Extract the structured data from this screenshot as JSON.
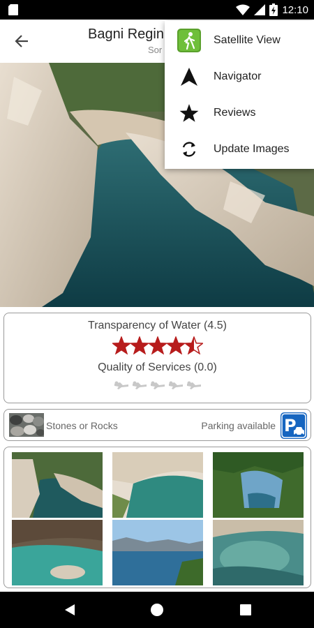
{
  "status_bar": {
    "time": "12:10"
  },
  "app_bar": {
    "title": "Bagni Regin",
    "subtitle": "Sor"
  },
  "menu": {
    "items": [
      {
        "label": "Satellite View",
        "icon": "hiker-icon"
      },
      {
        "label": "Navigator",
        "icon": "navigation-arrow-icon"
      },
      {
        "label": "Reviews",
        "icon": "star-icon"
      },
      {
        "label": "Update Images",
        "icon": "refresh-icon"
      }
    ]
  },
  "ratings": {
    "water": {
      "label": "Transparency of Water (4.5)",
      "value": 4.5,
      "max": 5,
      "color": "#b71c1c"
    },
    "services": {
      "label": "Quality of Services (0.0)",
      "value": 0.0,
      "max": 5,
      "color": "#c8c8c8"
    }
  },
  "info": {
    "beach_type": "Stones or Rocks",
    "parking": "Parking available",
    "parking_icon": "parking-car-icon"
  },
  "gallery": {
    "count": 6
  }
}
